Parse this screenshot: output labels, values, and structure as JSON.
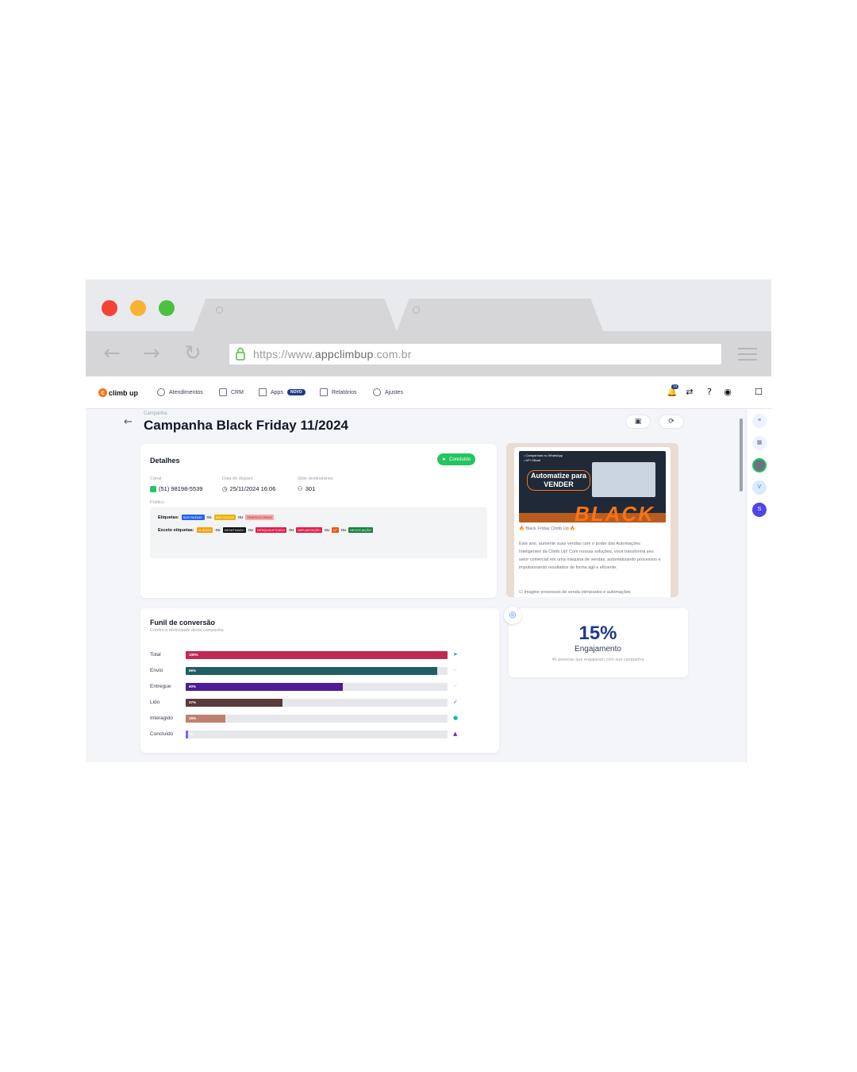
{
  "browser": {
    "url_prefix": "https://www.",
    "url_domain": "appclimbup",
    "url_suffix": ".com.br",
    "traffic_lights": [
      "#f44336",
      "#f9b233",
      "#4cc13f"
    ]
  },
  "app": {
    "logo": "climb up",
    "nav": [
      {
        "label": "Atendimentos",
        "icon": "chat-bubble-icon"
      },
      {
        "label": "CRM",
        "icon": "nodes-icon"
      },
      {
        "label": "Apps",
        "icon": "grid-icon",
        "badge": "NOVO"
      },
      {
        "label": "Relatórios",
        "icon": "report-icon"
      },
      {
        "label": "Ajustes",
        "icon": "gear-icon"
      }
    ],
    "notification_count": "10"
  },
  "page": {
    "breadcrumb": "Campanha",
    "title": "Campanha Black Friday 11/2024"
  },
  "details": {
    "heading": "Detalhes",
    "status": "Concluído",
    "channel_label": "Canal",
    "channel_value": "(51) 98198-5539",
    "date_label": "Data de disparo",
    "date_value": "25/11/2024 16:06",
    "recipients_label": "Qtde destinatários",
    "recipients_value": "301",
    "audience_label": "Público",
    "tags_label": "Etiquetas:",
    "except_label": "Exceto etiquetas:",
    "or": "ou",
    "tags": [
      {
        "text": "SDR RAFAEL",
        "color": "#2563eb"
      },
      {
        "text": "SDR SOUZA",
        "color": "#eab308"
      },
      {
        "text": "TRÁFEGO PAGO",
        "color": "#f9a8a8"
      }
    ],
    "except_tags": [
      {
        "text": "CLIENTE",
        "color": "#f59e0b"
      },
      {
        "text": "DESATIVADO",
        "color": "#111111"
      },
      {
        "text": "DESQUALIFICADO",
        "color": "#e11d48"
      },
      {
        "text": "IMPLANTAÇÃO",
        "color": "#e11d48"
      },
      {
        "text": "LP",
        "color": "#ea580c"
      },
      {
        "text": "NEGOCIAÇÃO",
        "color": "#15803d"
      }
    ]
  },
  "preview": {
    "promo_top": "• Campanhas no WhatsApp\n• API Oficial",
    "promo_head": "Automatize para\nVENDER",
    "promo_big": "BLACK",
    "title": "🔥 Black Friday Climb Up 🔥",
    "body": "Este ano, aumente suas vendas com o poder das Automações Inteligentes da Climb Up! Com nossas soluções, você transforma seu setor comercial em uma máquina de vendas, automatizando processos e impulsionando resultados de forma ágil e eficiente.",
    "bullet": "☑ Imagine processos de venda otimizados e automações"
  },
  "funnel": {
    "heading": "Funil de conversão",
    "subheading": "Confira a efetividade desta campanha",
    "rows": [
      {
        "label": "Total",
        "pct": "100%",
        "value": 100,
        "color": "#be2a52",
        "icon": "send-icon",
        "glyph": "➤",
        "icon_color": "#3b82f6"
      },
      {
        "label": "Envio",
        "pct": "96%",
        "value": 96,
        "color": "#1f5e63",
        "icon": "check-icon",
        "glyph": "✓",
        "icon_color": "#d1d5db"
      },
      {
        "label": "Entregue",
        "pct": "60%",
        "value": 60,
        "color": "#4c1d95",
        "icon": "double-check-icon",
        "glyph": "✓",
        "icon_color": "#d1d5db"
      },
      {
        "label": "Lido",
        "pct": "37%",
        "value": 37,
        "color": "#5a3a3a",
        "icon": "double-check-read-icon",
        "glyph": "✓",
        "icon_color": "#7c3aed"
      },
      {
        "label": "Interagido",
        "pct": "15%",
        "value": 15,
        "color": "#c08070",
        "icon": "chat-dot-icon",
        "glyph": "●",
        "icon_color": "#14b8a6"
      },
      {
        "label": "Concluído",
        "pct": "1%",
        "value": 1,
        "color": "#8b5cf6",
        "icon": "thumbs-up-icon",
        "glyph": "▲",
        "icon_color": "#6d28d9"
      }
    ]
  },
  "engagement": {
    "value": "15%",
    "label": "Engajamento",
    "sub": "46 pessoas que engajaram com sua campanha"
  },
  "rail": [
    "V",
    "S"
  ]
}
